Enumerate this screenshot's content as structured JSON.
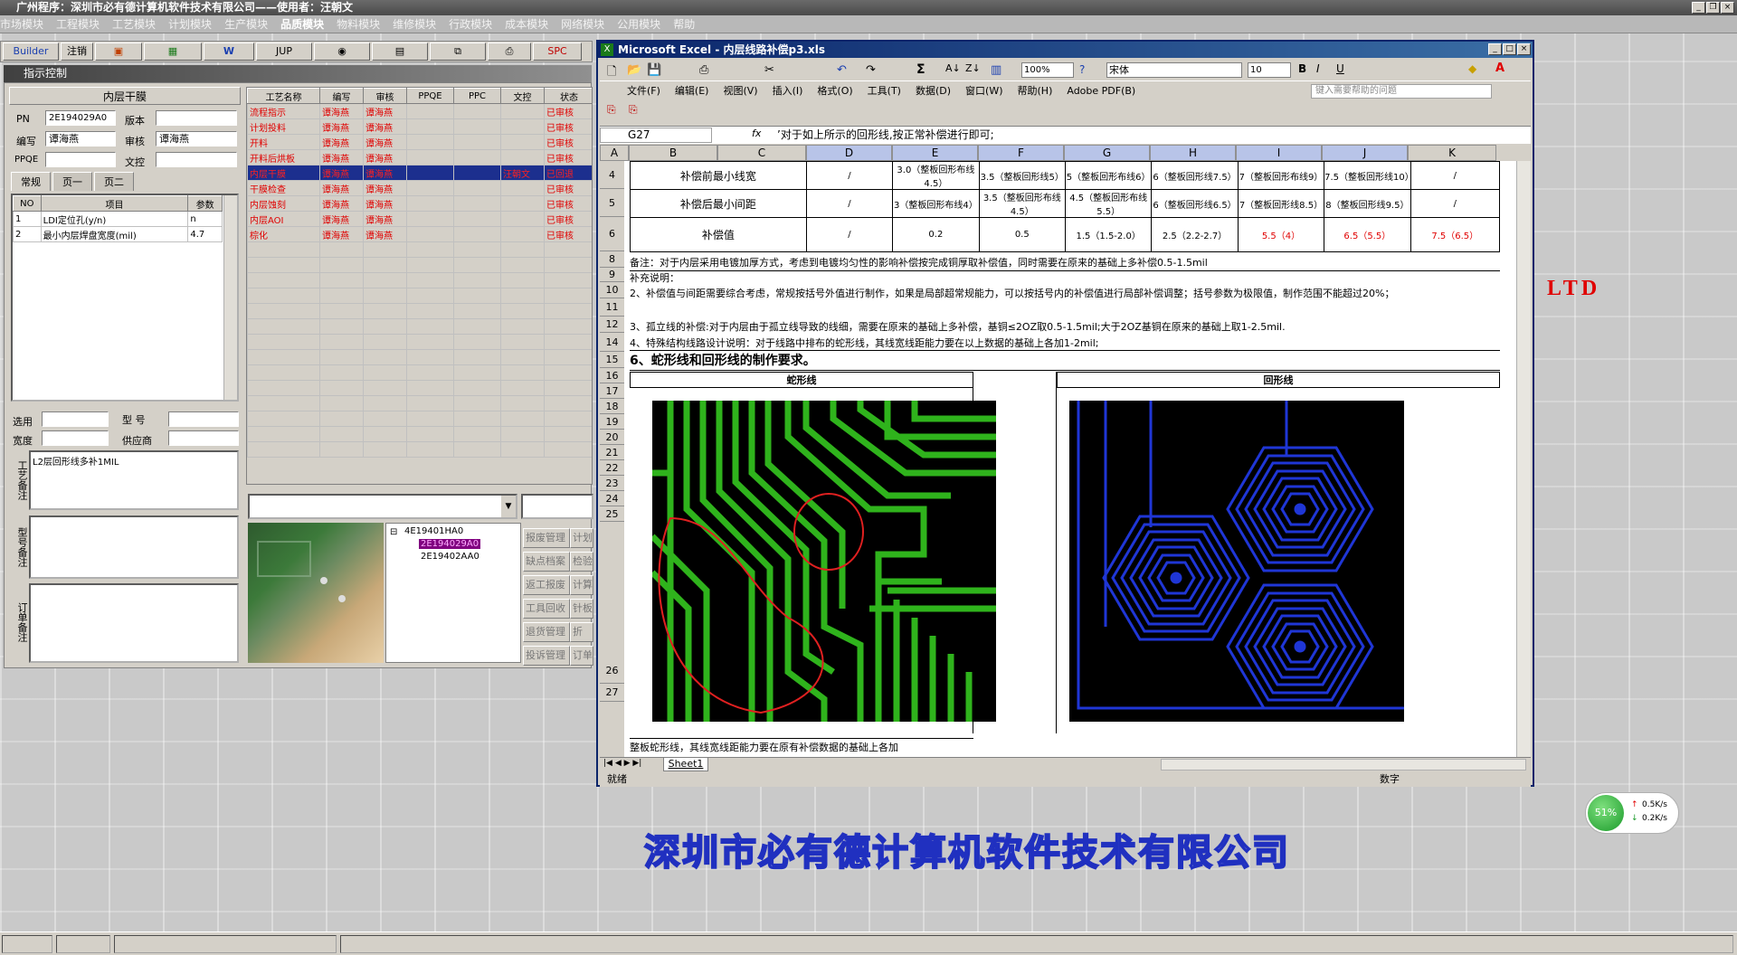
{
  "app": {
    "title": "广州程序：深圳市必有德计算机软件技术有限公司——使用者：汪朝文"
  },
  "menu": [
    "市场模块",
    "工程模块",
    "工艺模块",
    "计划模块",
    "生产模块",
    "品质模块",
    "物料模块",
    "维修模块",
    "行政模块",
    "成本模块",
    "网络模块",
    "公用模块",
    "帮助"
  ],
  "toolbar": {
    "builder": "Builder",
    "logout": "注销",
    "jup": "JUP",
    "spc": "SPC"
  },
  "left": {
    "window_title": "指示控制",
    "panel_title": "内层干膜",
    "pn_label": "PN",
    "pn_value": "2E194029A0",
    "version_label": "版本",
    "writer_label": "编写",
    "writer_value": "谭海燕",
    "reviewer_label": "审核",
    "reviewer_value": "谭海燕",
    "ppqe_label": "PPQE",
    "control_label": "文控",
    "tabs": [
      "常规",
      "页一",
      "页二"
    ],
    "param_headers": [
      "NO",
      "项目",
      "参数"
    ],
    "params": [
      {
        "no": "1",
        "item": "LDI定位孔(y/n)",
        "value": "n"
      },
      {
        "no": "2",
        "item": "最小内层焊盘宽度(mil)",
        "value": "4.7"
      }
    ],
    "select_label": "选用",
    "model_label": "型 号",
    "width_label": "宽度",
    "supplier_label": "供应商",
    "note_label1": "工艺备注",
    "note_text": "L2层回形线多补1MIL",
    "note_label2": "型号备注",
    "note_label3": "订单备注"
  },
  "process": {
    "headers": [
      "工艺名称",
      "编写",
      "审核",
      "PPQE",
      "PPC",
      "文控",
      "状态"
    ],
    "rows": [
      {
        "name": "流程指示",
        "writer": "谭海燕",
        "reviewer": "谭海燕",
        "control": "",
        "status": "已审核"
      },
      {
        "name": "计划投料",
        "writer": "谭海燕",
        "reviewer": "谭海燕",
        "control": "",
        "status": "已审核"
      },
      {
        "name": "开料",
        "writer": "谭海燕",
        "reviewer": "谭海燕",
        "control": "",
        "status": "已审核"
      },
      {
        "name": "开料后烘板",
        "writer": "谭海燕",
        "reviewer": "谭海燕",
        "control": "",
        "status": "已审核"
      },
      {
        "name": "内层干膜",
        "writer": "谭海燕",
        "reviewer": "谭海燕",
        "control": "汪朝文",
        "status": "已回退"
      },
      {
        "name": "干膜检查",
        "writer": "谭海燕",
        "reviewer": "谭海燕",
        "control": "",
        "status": "已审核"
      },
      {
        "name": "内层蚀刻",
        "writer": "谭海燕",
        "reviewer": "谭海燕",
        "control": "",
        "status": "已审核"
      },
      {
        "name": "内层AOI",
        "writer": "谭海燕",
        "reviewer": "谭海燕",
        "control": "",
        "status": "已审核"
      },
      {
        "name": "棕化",
        "writer": "谭海燕",
        "reviewer": "谭海燕",
        "control": "",
        "status": "已审核"
      }
    ]
  },
  "tree": {
    "items": [
      "4E19401HA0",
      "2E194029A0",
      "2E19402AA0"
    ]
  },
  "side_buttons": [
    [
      "报废管理",
      "计划"
    ],
    [
      "缺点档案",
      "检验"
    ],
    [
      "返工报废",
      "计算"
    ],
    [
      "工具回收",
      "针板"
    ],
    [
      "退货管理",
      "折"
    ],
    [
      "投诉管理",
      "订单"
    ]
  ],
  "excel": {
    "title": "Microsoft Excel - 内层线路补偿p3.xls",
    "menus": [
      "文件(F)",
      "编辑(E)",
      "视图(V)",
      "插入(I)",
      "格式(O)",
      "工具(T)",
      "数据(D)",
      "窗口(W)",
      "帮助(H)",
      "Adobe PDF(B)"
    ],
    "zoom": "100%",
    "font": "宋体",
    "fontsize": "10",
    "help_placeholder": "键入需要帮助的问题",
    "cellref": "G27",
    "formula": "’对于如上所示的回形线,按正常补偿进行即可;",
    "cols": [
      "A",
      "B",
      "C",
      "D",
      "E",
      "F",
      "G",
      "H",
      "I",
      "J",
      "K"
    ],
    "row4": {
      "label": "补偿前最小线宽",
      "d": "/",
      "e": "3.0（整板回形布线4.5）",
      "f": "3.5（整板回形线5）",
      "g": "5（整板回形布线6）",
      "h": "6（整板回形线7.5）",
      "i": "7（整板回形布线9）",
      "j": "7.5（整板回形线10）",
      "k": "/"
    },
    "row5": {
      "label": "补偿后最小间距",
      "d": "/",
      "e": "3（整板回形布线4）",
      "f": "3.5（整板回形布线4.5）",
      "g": "4.5（整板回形布线5.5）",
      "h": "6（整板回形线6.5）",
      "i": "7（整板回形线8.5）",
      "j": "8（整板回形线9.5）",
      "k": "/"
    },
    "row6": {
      "label": "补偿值",
      "d": "/",
      "e": "0.2",
      "f": "0.5",
      "g": "1.5（1.5-2.0）",
      "h": "2.5（2.2-2.7）",
      "i": "5.5（4）",
      "j": "6.5（5.5）",
      "k": "7.5（6.5）"
    },
    "row8": "备注：对于内层采用电镀加厚方式，考虑到电镀均匀性的影响补偿按完成铜厚取补偿值，同时需要在原来的基础上多补偿0.5-1.5mil",
    "row9": "补充说明：",
    "row10": "2、补偿值与间距需要综合考虑，常规按括号外值进行制作，如果是局部超常规能力，可以按括号内的补偿值进行局部补偿调整；括号参数为极限值，制作范围不能超过20%；",
    "row11": "3、孤立线的补偿:对于内层由于孤立线导致的线细，需要在原来的基础上多补偿，基铜≤2OZ取0.5-1.5mil;大于2OZ基铜在原来的基础上取1-2.5mil.",
    "row12": "4、特殊结构线路设计说明：对于线路中排布的蛇形线，其线宽线距能力要在以上数据的基础上各加1-2mil;",
    "row14": "6、蛇形线和回形线的制作要求。",
    "snake_header": "蛇形线",
    "loop_header": "回形线",
    "row27": "整板蛇形线，其线宽线距能力要在原有补偿数据的基础上各加",
    "sheet_tab": "Sheet1",
    "status_ready": "就绪",
    "status_num": "数字"
  },
  "ltd": "LTD",
  "company_banner": "深圳市必有德计算机软件技术有限公司",
  "net": {
    "percent": "51%",
    "up": "0.5K/s",
    "down": "0.2K/s"
  }
}
